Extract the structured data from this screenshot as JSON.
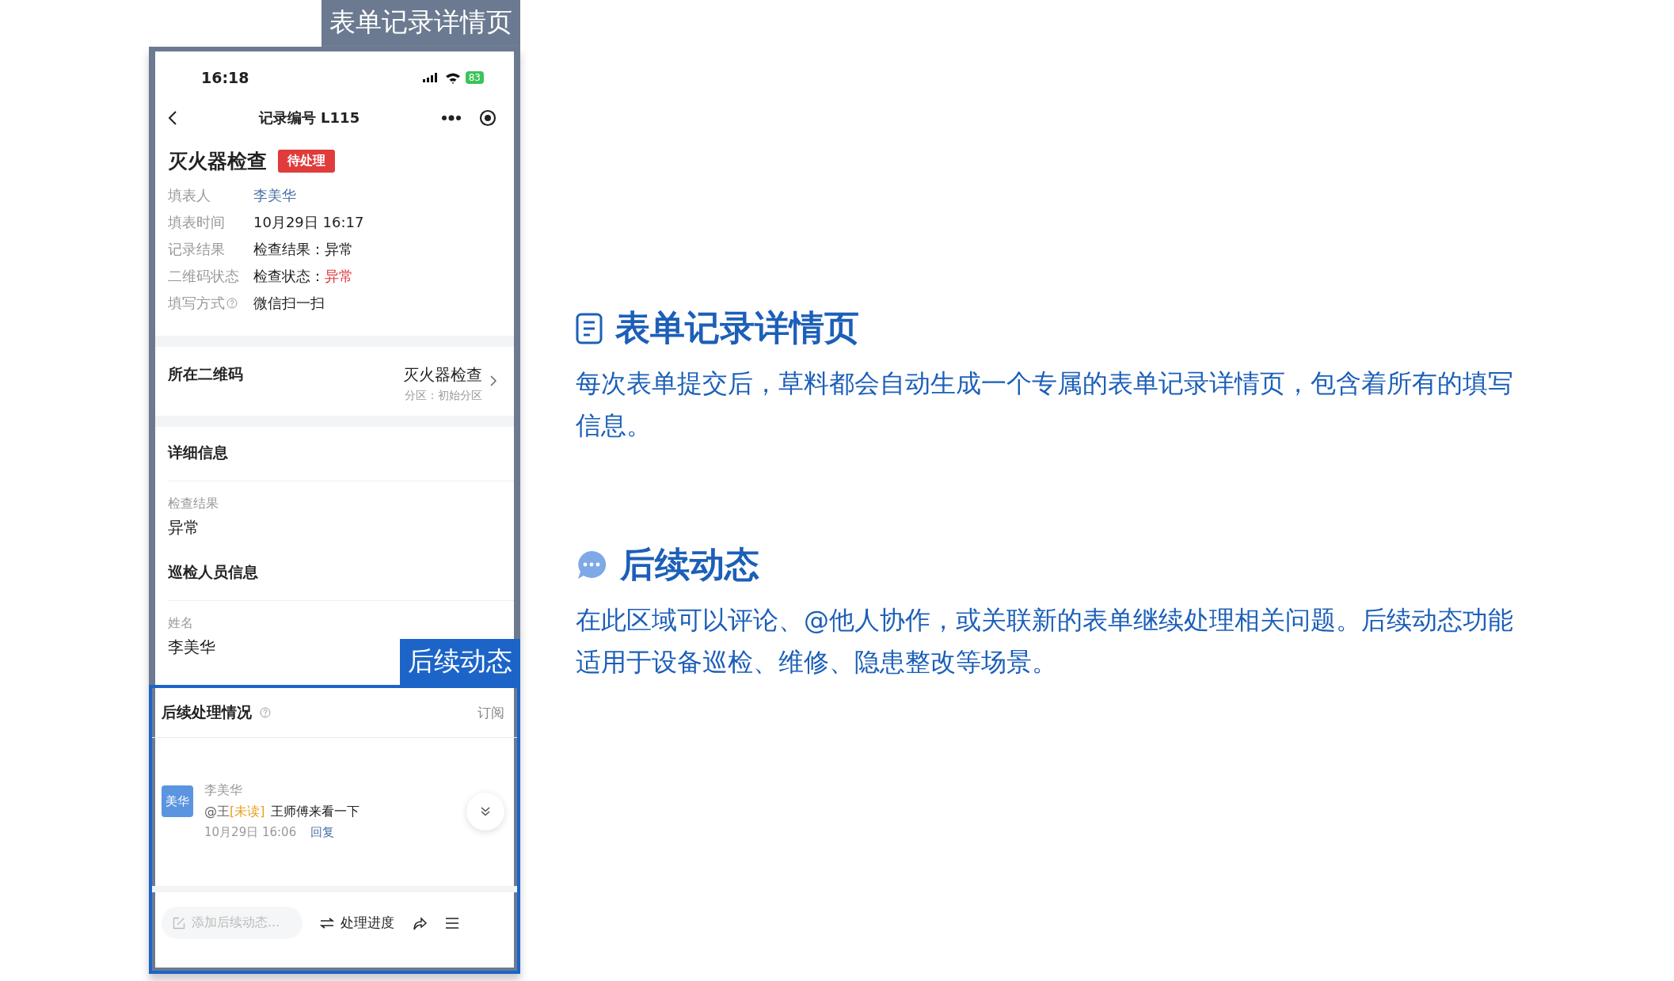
{
  "top_label": "表单记录详情页",
  "status_bar": {
    "time": "16:18",
    "battery": "83"
  },
  "nav": {
    "title": "记录编号 L115"
  },
  "record": {
    "title": "灭火器检查",
    "badge": "待处理",
    "rows": [
      {
        "label": "填表人",
        "kind": "link",
        "value": "李美华"
      },
      {
        "label": "填表时间",
        "kind": "plain",
        "value": "10月29日 16:17"
      },
      {
        "label": "记录结果",
        "kind": "plain",
        "value": "检查结果：异常"
      },
      {
        "label": "二维码状态",
        "kind": "status",
        "prefix": "检查状态：",
        "value": "异常"
      },
      {
        "label": "填写方式",
        "kind": "plain",
        "value": "微信扫一扫",
        "help": true
      }
    ]
  },
  "qr": {
    "label": "所在二维码",
    "name": "灭火器检查",
    "zone": "分区：初始分区"
  },
  "details": {
    "title": "详细信息",
    "fields": [
      {
        "kind": "field",
        "label": "检查结果",
        "value": "异常"
      },
      {
        "kind": "group",
        "title": "巡检人员信息"
      },
      {
        "kind": "field",
        "label": "姓名",
        "value": "李美华"
      }
    ]
  },
  "overlay_label": "后续动态",
  "followup": {
    "title": "后续处理情况",
    "subscribe": "订阅",
    "comment": {
      "avatar": "美华",
      "author": "李美华",
      "mention": "@王",
      "unread": "[未读]",
      "text": "王师傅来看一下",
      "time": "10月29日 16:06",
      "reply": "回复"
    }
  },
  "bottom_bar": {
    "placeholder": "添加后续动态...",
    "progress": "处理进度"
  },
  "sections": [
    {
      "kind": "document",
      "title": "表单记录详情页",
      "text": "每次表单提交后，草料都会自动生成一个专属的表单记录详情页，包含着所有的填写信息。"
    },
    {
      "kind": "chat",
      "title": "后续动态",
      "text": "在此区域可以评论、@他人协作，或关联新的表单继续处理相关问题。后续动态功能适用于设备巡检、维修、隐患整改等场景。"
    }
  ]
}
